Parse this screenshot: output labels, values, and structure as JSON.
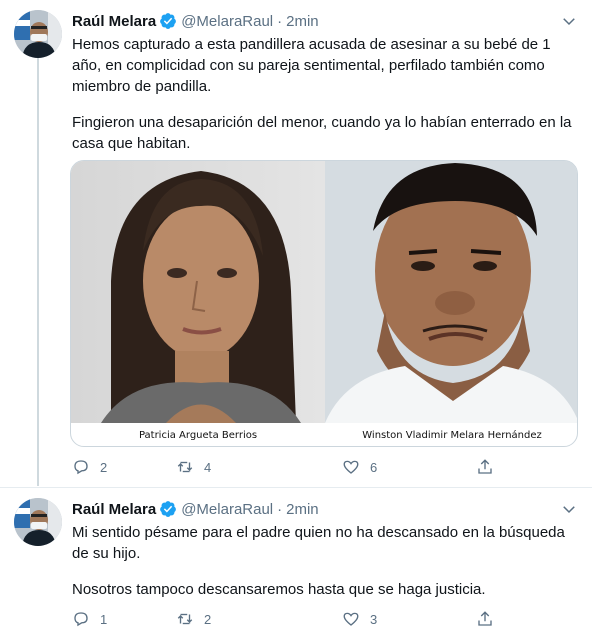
{
  "colors": {
    "secondary_text": "#5b7083",
    "verified_blue": "#1da1f2",
    "thread_line": "#cfd9de",
    "border": "#e6ecf0"
  },
  "tweets": [
    {
      "author_name": "Raúl Melara",
      "handle": "@MelaraRaul",
      "separator": "·",
      "time": "2min",
      "paragraphs": [
        "Hemos capturado a esta pandillera acusada de asesinar a su bebé de 1 año, en complicidad con su pareja sentimental, perfilado también como miembro de pandilla.",
        "Fingieron una desaparición del menor, cuando ya lo habían enterrado en la casa que habitan."
      ],
      "media": {
        "left_caption": "Patricia Argueta Berrios",
        "right_caption": "Winston Vladimir Melara Hernández"
      },
      "actions": {
        "replies": "2",
        "retweets": "4",
        "likes": "6"
      }
    },
    {
      "author_name": "Raúl Melara",
      "handle": "@MelaraRaul",
      "separator": "·",
      "time": "2min",
      "paragraphs": [
        "Mi sentido pésame para el padre quien no ha descansado en la búsqueda de su hijo.",
        "Nosotros tampoco descansaremos hasta que se haga justicia."
      ],
      "actions": {
        "replies": "1",
        "retweets": "2",
        "likes": "3"
      }
    }
  ],
  "icons": {
    "reply": "reply-icon",
    "retweet": "retweet-icon",
    "like": "heart-icon",
    "share": "share-icon",
    "more": "chevron-down-icon",
    "verified": "verified-badge-icon"
  }
}
